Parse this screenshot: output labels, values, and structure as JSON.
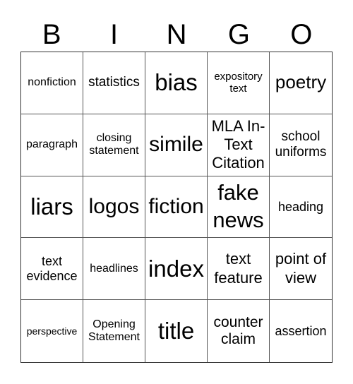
{
  "header": [
    "B",
    "I",
    "N",
    "G",
    "O"
  ],
  "cells": [
    "nonfiction",
    "statistics",
    "bias",
    "expository text",
    "poetry",
    "paragraph",
    "closing statement",
    "simile",
    "MLA In-Text Citation",
    "school uniforms",
    "liars",
    "logos",
    "fiction",
    "fake news",
    "heading",
    "text evidence",
    "headlines",
    "index",
    "text feature",
    "point of view",
    "perspective",
    "Opening Statement",
    "title",
    "counter claim",
    "assertion"
  ]
}
